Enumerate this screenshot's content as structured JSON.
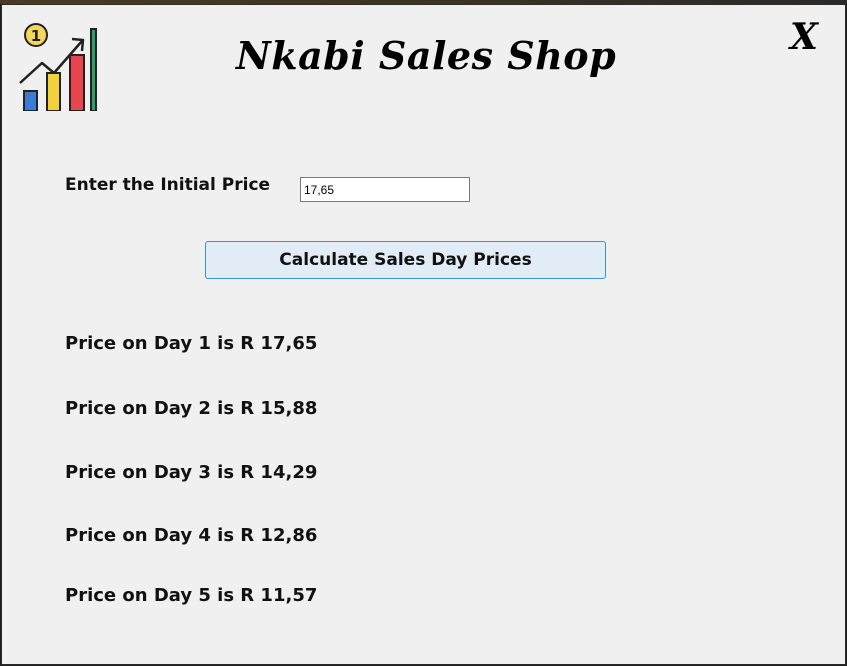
{
  "window": {
    "title": "Nkabi Sales Shop",
    "close_label": "X"
  },
  "logo": {
    "icon": "sales-growth-chart-icon",
    "badge_text": "1",
    "colors": [
      "#3b7bd1",
      "#f2d23a",
      "#e8454f",
      "#2aa36b"
    ]
  },
  "form": {
    "prompt_label": "Enter the Initial Price",
    "price_value": "17,65"
  },
  "actions": {
    "calculate_label": "Calculate Sales Day Prices"
  },
  "results": [
    "Price on Day 1 is R 17,65",
    "Price on Day 2 is R 15,88",
    "Price on Day 3 is R 14,29",
    "Price on Day 4 is R 12,86",
    "Price on Day 5 is R 11,57"
  ]
}
